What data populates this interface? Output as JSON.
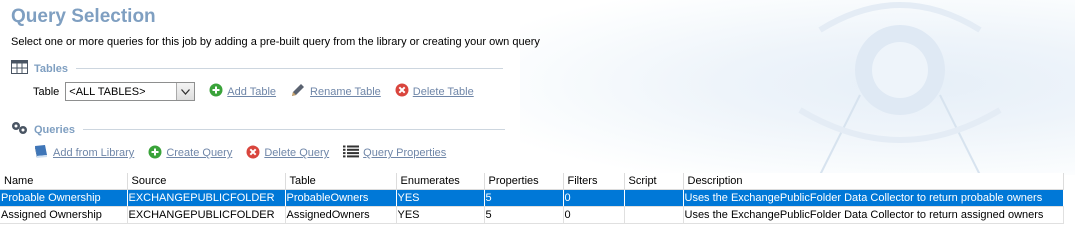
{
  "header": {
    "title": "Query Selection",
    "subtitle": "Select one or more queries for this job by adding a pre-built query from the library or creating your own query"
  },
  "tables_section": {
    "heading": "Tables",
    "table_label": "Table",
    "table_select_value": "<ALL TABLES>",
    "add_table": "Add Table",
    "rename_table": "Rename Table",
    "delete_table": "Delete Table"
  },
  "queries_section": {
    "heading": "Queries",
    "add_from_library": "Add from Library",
    "create_query": "Create Query",
    "delete_query": "Delete Query",
    "query_properties": "Query Properties"
  },
  "grid": {
    "columns": [
      "Name",
      "Source",
      "Table",
      "Enumerates",
      "Properties",
      "Filters",
      "Script",
      "Description"
    ],
    "rows": [
      {
        "name": "Probable Ownership",
        "source": "EXCHANGEPUBLICFOLDER",
        "table": "ProbableOwners",
        "enumerates": "YES",
        "properties": "5",
        "filters": "0",
        "script": "",
        "description": "Uses the ExchangePublicFolder Data Collector to return probable owners",
        "selected": true
      },
      {
        "name": "Assigned Ownership",
        "source": "EXCHANGEPUBLICFOLDER",
        "table": "AssignedOwners",
        "enumerates": "YES",
        "properties": "5",
        "filters": "0",
        "script": "",
        "description": "Uses the ExchangePublicFolder Data Collector to return assigned owners",
        "selected": false
      }
    ]
  },
  "colors": {
    "title": "#7f9fc1",
    "link": "#6f86a8",
    "selection": "#0078d7",
    "add_green": "#3aa33a",
    "delete_red": "#d9453d"
  }
}
